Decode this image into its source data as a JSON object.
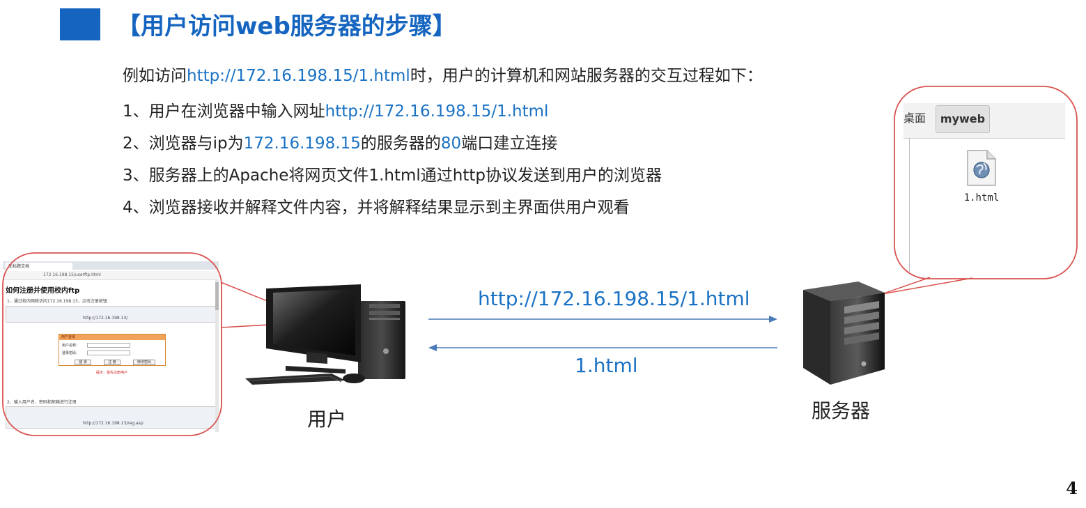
{
  "title": "【用户访问web服务器的步骤】",
  "intro": {
    "prefix": "例如访问",
    "url": "http://172.16.198.15/1.html",
    "suffix": "时，用户的计算机和网站服务器的交互过程如下："
  },
  "steps": {
    "s1": {
      "prefix": "1、用户在浏览器中输入网址",
      "url": "http://172.16.198.15/1.html"
    },
    "s2": {
      "prefix": "2、浏览器与ip为",
      "ip": "172.16.198.15",
      "mid": "的服务器的",
      "port": "80",
      "suffix": "端口建立连接"
    },
    "s3": {
      "text": "3、服务器上的Apache将网页文件1.html通过http协议发送到用户的浏览器"
    },
    "s4": {
      "text": "4、浏览器接收并解释文件内容，并将解释结果显示到主界面供用户观看"
    }
  },
  "diagram": {
    "request_label": "http://172.16.198.15/1.html",
    "response_label": "1.html",
    "user_label": "用户",
    "server_label": "服务器"
  },
  "browser_screenshot": {
    "tab": "无标题文档",
    "url": "172.16.198.15/userftp.html",
    "heading": "如何注册并使用校内ftp",
    "step1": "1、通过校内网络访问172.16.198.13，点击注册按钮",
    "inner_url": "http://172.16.198.13/",
    "form_title": "用户登录",
    "username_label": "用户名称：",
    "password_label": "登录密码：",
    "btn_login": "登 录",
    "btn_register": "注 册",
    "btn_reset": "修改密码",
    "note": "提示：首先注册用户",
    "step2": "2、输入用户名、密码和邮箱进行注册",
    "inner_url2": "http://172.16.198.13/reg.asp"
  },
  "file_manager": {
    "tab_desktop": "桌面",
    "tab_folder": "myweb",
    "file_name": "1.html"
  },
  "page_number": "4",
  "colors": {
    "accent": "#1565c0",
    "link": "#1a72c4",
    "callout": "#d9534f"
  }
}
